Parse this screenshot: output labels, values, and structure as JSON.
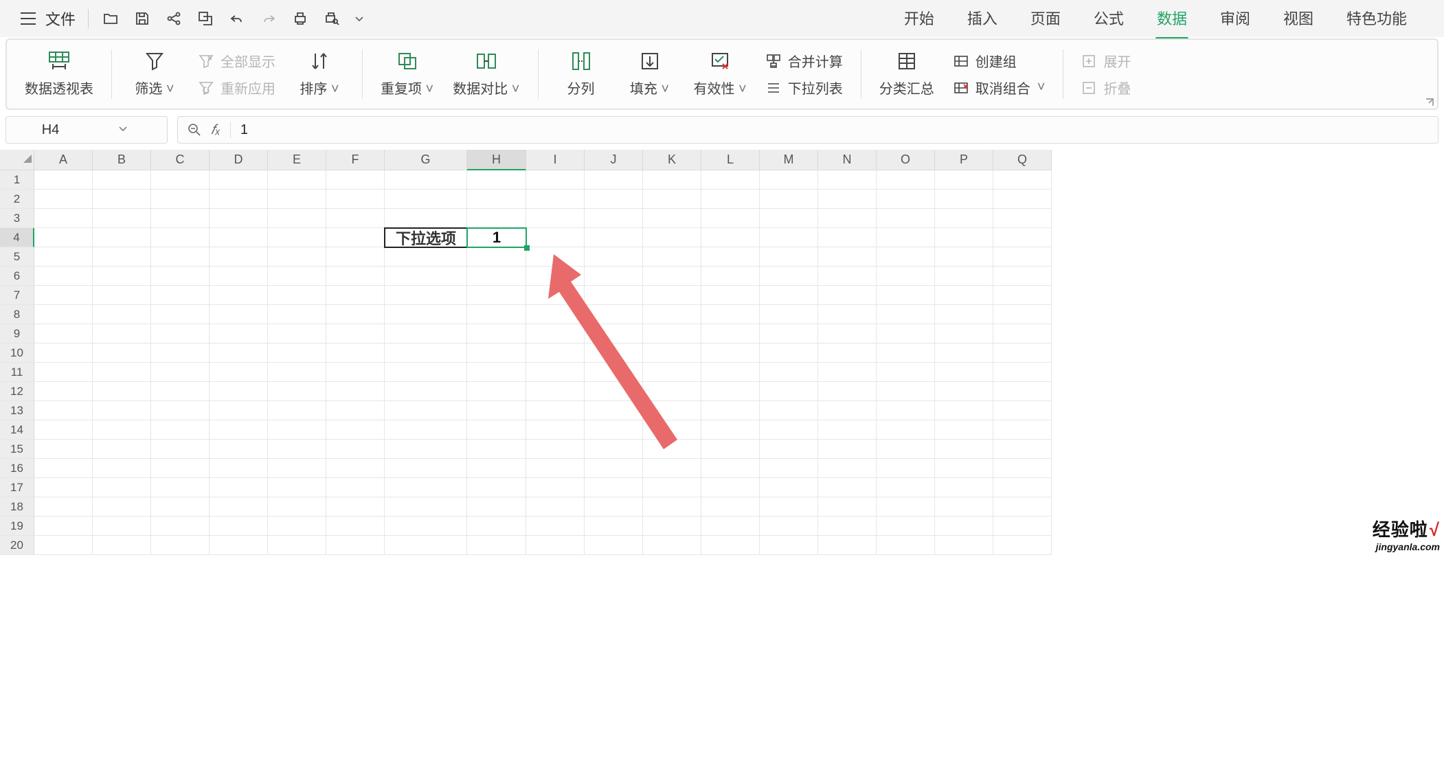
{
  "menubar": {
    "file_label": "文件"
  },
  "tabs": {
    "items": [
      "开始",
      "插入",
      "页面",
      "公式",
      "数据",
      "审阅",
      "视图",
      "特色功能"
    ],
    "active_index": 4
  },
  "ribbon": {
    "pivot": "数据透视表",
    "filter": "筛选",
    "show_all": "全部显示",
    "reapply": "重新应用",
    "sort": "排序",
    "dup": "重复项",
    "compare": "数据对比",
    "split_cols": "分列",
    "fill": "填充",
    "validation": "有效性",
    "consolidate": "合并计算",
    "dropdown": "下拉列表",
    "subtotal": "分类汇总",
    "group": "创建组",
    "ungroup": "取消组合",
    "expand": "展开",
    "collapse": "折叠"
  },
  "name_box": {
    "value": "H4"
  },
  "formula_bar": {
    "fx_label": "𝑓ₓ",
    "value": "1"
  },
  "columns": [
    "A",
    "B",
    "C",
    "D",
    "E",
    "F",
    "G",
    "H",
    "I",
    "J",
    "K",
    "L",
    "M",
    "N",
    "O",
    "P",
    "Q"
  ],
  "rows": [
    "1",
    "2",
    "3",
    "4",
    "5",
    "6",
    "7",
    "8",
    "9",
    "10",
    "11",
    "12",
    "13",
    "14",
    "15",
    "16",
    "17",
    "18",
    "19",
    "20"
  ],
  "selected": {
    "col_index": 7,
    "row_index": 3
  },
  "cells": {
    "G4": "下拉选项",
    "H4": "1"
  },
  "watermark": {
    "line1": "经验啦",
    "check": "√",
    "line2": "jingyanla.com"
  }
}
